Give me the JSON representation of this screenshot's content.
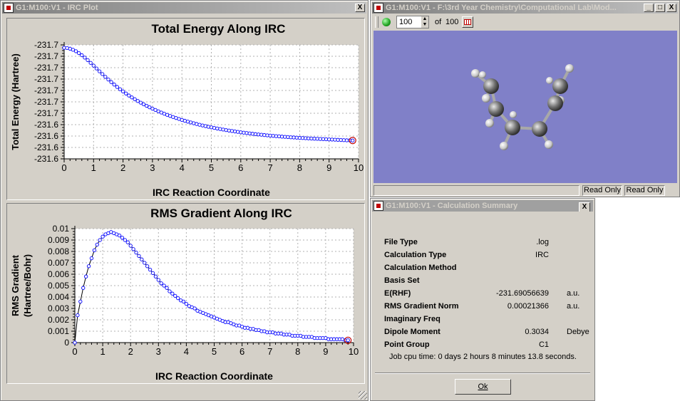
{
  "irc_window": {
    "title": "G1:M100:V1 - IRC Plot",
    "close_symbol": "X"
  },
  "chart_data": [
    {
      "type": "line",
      "title": "Total Energy Along IRC",
      "xlabel": "IRC Reaction Coordinate",
      "ylabel": "Total Energy (Hartree)",
      "x_ticks": [
        "0",
        "1",
        "2",
        "3",
        "4",
        "5",
        "6",
        "7",
        "8",
        "9",
        "10"
      ],
      "y_tick_labels": [
        "-231.6",
        "-231.6",
        "-231.6",
        "-231.6",
        "-231.7",
        "-231.7",
        "-231.7",
        "-231.7",
        "-231.7",
        "-231.7",
        "-231.7"
      ],
      "xlim": [
        0,
        10
      ],
      "ylim": [
        -231.6906,
        -231.675
      ],
      "grid": true,
      "series_color": "#0000ff",
      "x": [
        0,
        0.1,
        0.2,
        0.3,
        0.4,
        0.5,
        0.6,
        0.7,
        0.8,
        0.9,
        1,
        1.1,
        1.2,
        1.3,
        1.4,
        1.5,
        1.6,
        1.7,
        1.8,
        1.9,
        2,
        2.1,
        2.2,
        2.3,
        2.4,
        2.5,
        2.6,
        2.7,
        2.8,
        2.9,
        3,
        3.1,
        3.2,
        3.3,
        3.4,
        3.5,
        3.6,
        3.7,
        3.8,
        3.9,
        4,
        4.1,
        4.2,
        4.3,
        4.4,
        4.5,
        4.6,
        4.7,
        4.8,
        4.9,
        5,
        5.1,
        5.2,
        5.3,
        5.4,
        5.5,
        5.6,
        5.7,
        5.8,
        5.9,
        6,
        6.1,
        6.2,
        6.3,
        6.4,
        6.5,
        6.6,
        6.7,
        6.8,
        6.9,
        7,
        7.1,
        7.2,
        7.3,
        7.4,
        7.5,
        7.6,
        7.7,
        7.8,
        7.9,
        8,
        8.1,
        8.2,
        8.3,
        8.4,
        8.5,
        8.6,
        8.7,
        8.8,
        8.9,
        9,
        9.1,
        9.2,
        9.3,
        9.4,
        9.5,
        9.6,
        9.7,
        9.8
      ],
      "y": [
        -231.6754,
        -231.67543,
        -231.67552,
        -231.67567,
        -231.67587,
        -231.67612,
        -231.67641,
        -231.67674,
        -231.67709,
        -231.67746,
        -231.67784,
        -231.67823,
        -231.67862,
        -231.679,
        -231.67938,
        -231.67974,
        -231.68009,
        -231.68043,
        -231.68076,
        -231.68107,
        -231.68137,
        -231.68166,
        -231.68193,
        -231.68219,
        -231.68244,
        -231.68268,
        -231.68291,
        -231.68313,
        -231.68334,
        -231.68354,
        -231.68373,
        -231.68391,
        -231.68409,
        -231.68426,
        -231.68442,
        -231.68458,
        -231.68473,
        -231.68487,
        -231.68501,
        -231.68514,
        -231.68527,
        -231.68539,
        -231.68551,
        -231.68562,
        -231.68573,
        -231.68583,
        -231.68593,
        -231.68603,
        -231.68612,
        -231.68621,
        -231.68629,
        -231.68637,
        -231.68645,
        -231.68652,
        -231.68659,
        -231.68666,
        -231.68673,
        -231.68679,
        -231.68685,
        -231.68691,
        -231.68697,
        -231.68702,
        -231.68707,
        -231.68712,
        -231.68717,
        -231.68722,
        -231.68726,
        -231.6873,
        -231.68734,
        -231.68738,
        -231.68742,
        -231.68746,
        -231.68749,
        -231.68752,
        -231.68756,
        -231.68759,
        -231.68762,
        -231.68765,
        -231.68767,
        -231.6877,
        -231.68773,
        -231.68775,
        -231.68777,
        -231.6878,
        -231.68782,
        -231.68784,
        -231.68786,
        -231.68788,
        -231.6879,
        -231.68792,
        -231.68794,
        -231.68796,
        -231.68798,
        -231.688,
        -231.68802,
        -231.68804,
        -231.68806,
        -231.68807,
        -231.68809
      ]
    },
    {
      "type": "line",
      "title": "RMS Gradient Along IRC",
      "xlabel": "IRC Reaction Coordinate",
      "ylabel": "RMS Gradient (Hartree/Bohr)",
      "x_ticks": [
        "0",
        "1",
        "2",
        "3",
        "4",
        "5",
        "6",
        "7",
        "8",
        "9",
        "10"
      ],
      "y_tick_labels": [
        "0",
        "0.001",
        "0.002",
        "0.003",
        "0.004",
        "0.005",
        "0.006",
        "0.007",
        "0.008",
        "0.009",
        "0.01"
      ],
      "xlim": [
        0,
        10
      ],
      "ylim": [
        0,
        0.01
      ],
      "grid": true,
      "series_color": "#0000ff",
      "x": [
        0,
        0.1,
        0.2,
        0.3,
        0.4,
        0.5,
        0.6,
        0.7,
        0.8,
        0.9,
        1,
        1.1,
        1.2,
        1.3,
        1.4,
        1.5,
        1.6,
        1.7,
        1.8,
        1.9,
        2,
        2.1,
        2.2,
        2.3,
        2.4,
        2.5,
        2.6,
        2.7,
        2.8,
        2.9,
        3,
        3.1,
        3.2,
        3.3,
        3.4,
        3.5,
        3.6,
        3.7,
        3.8,
        3.9,
        4,
        4.1,
        4.2,
        4.3,
        4.4,
        4.5,
        4.6,
        4.7,
        4.8,
        4.9,
        5,
        5.1,
        5.2,
        5.3,
        5.4,
        5.5,
        5.6,
        5.7,
        5.8,
        5.9,
        6,
        6.1,
        6.2,
        6.3,
        6.4,
        6.5,
        6.6,
        6.7,
        6.8,
        6.9,
        7,
        7.1,
        7.2,
        7.3,
        7.4,
        7.5,
        7.6,
        7.7,
        7.8,
        7.9,
        8,
        8.1,
        8.2,
        8.3,
        8.4,
        8.5,
        8.6,
        8.7,
        8.8,
        8.9,
        9,
        9.1,
        9.2,
        9.3,
        9.4,
        9.5,
        9.6,
        9.7,
        9.8
      ],
      "y": [
        0,
        0.0024,
        0.0036,
        0.0048,
        0.0058,
        0.0067,
        0.0074,
        0.0081,
        0.0086,
        0.009,
        0.0093,
        0.0095,
        0.0096,
        0.0097,
        0.0096,
        0.0095,
        0.0094,
        0.0092,
        0.009,
        0.0088,
        0.0085,
        0.0082,
        0.0079,
        0.0076,
        0.0073,
        0.007,
        0.0067,
        0.0064,
        0.0061,
        0.0058,
        0.0055,
        0.0052,
        0.005,
        0.0048,
        0.0045,
        0.0043,
        0.0041,
        0.0039,
        0.0037,
        0.0036,
        0.0034,
        0.0032,
        0.0031,
        0.003,
        0.0028,
        0.0027,
        0.0026,
        0.0025,
        0.0024,
        0.0023,
        0.0022,
        0.0021,
        0.002,
        0.0019,
        0.0018,
        0.0018,
        0.0017,
        0.0016,
        0.0015,
        0.0015,
        0.0014,
        0.0013,
        0.0013,
        0.0012,
        0.0012,
        0.0011,
        0.0011,
        0.001,
        0.001,
        0.0009,
        0.0009,
        0.0009,
        0.0008,
        0.0008,
        0.0008,
        0.0007,
        0.0007,
        0.0007,
        0.0006,
        0.0006,
        0.0006,
        0.0006,
        0.0005,
        0.0005,
        0.0005,
        0.0005,
        0.0004,
        0.0004,
        0.0004,
        0.0004,
        0.0004,
        0.0003,
        0.0003,
        0.0003,
        0.0003,
        0.0003,
        0.0003,
        0.0002,
        0.0002
      ]
    }
  ],
  "molecule_window": {
    "title": "G1:M100:V1 - F:\\3rd Year Chemistry\\Computational Lab\\Mod...",
    "frame_value": "100",
    "of_label": "of",
    "frame_total": "100",
    "status_left": "",
    "status_mid": "Read Only",
    "status_right": "Read Only",
    "viewport_color": "#8080c8",
    "minimize_symbol": "_",
    "maximize_symbol": "□",
    "close_symbol": "X"
  },
  "summary_window": {
    "title": "G1:M100:V1 - Calculation Summary",
    "close_symbol": "X",
    "rows": [
      {
        "label": "File Type",
        "value": ".log",
        "unit": ""
      },
      {
        "label": "Calculation Type",
        "value": "IRC",
        "unit": ""
      },
      {
        "label": "Calculation Method",
        "value": "",
        "unit": ""
      },
      {
        "label": "Basis Set",
        "value": "",
        "unit": ""
      },
      {
        "label": "E(RHF)",
        "value": "-231.69056639",
        "unit": "a.u."
      },
      {
        "label": "RMS Gradient Norm",
        "value": "0.00021366",
        "unit": "a.u."
      },
      {
        "label": "Imaginary Freq",
        "value": "",
        "unit": ""
      },
      {
        "label": "Dipole Moment",
        "value": "0.3034",
        "unit": "Debye"
      },
      {
        "label": "Point Group",
        "value": "C1",
        "unit": ""
      }
    ],
    "cpu_time": "Job cpu time:  0 days  2 hours  8 minutes 13.8 seconds.",
    "ok_label": "Ok"
  }
}
